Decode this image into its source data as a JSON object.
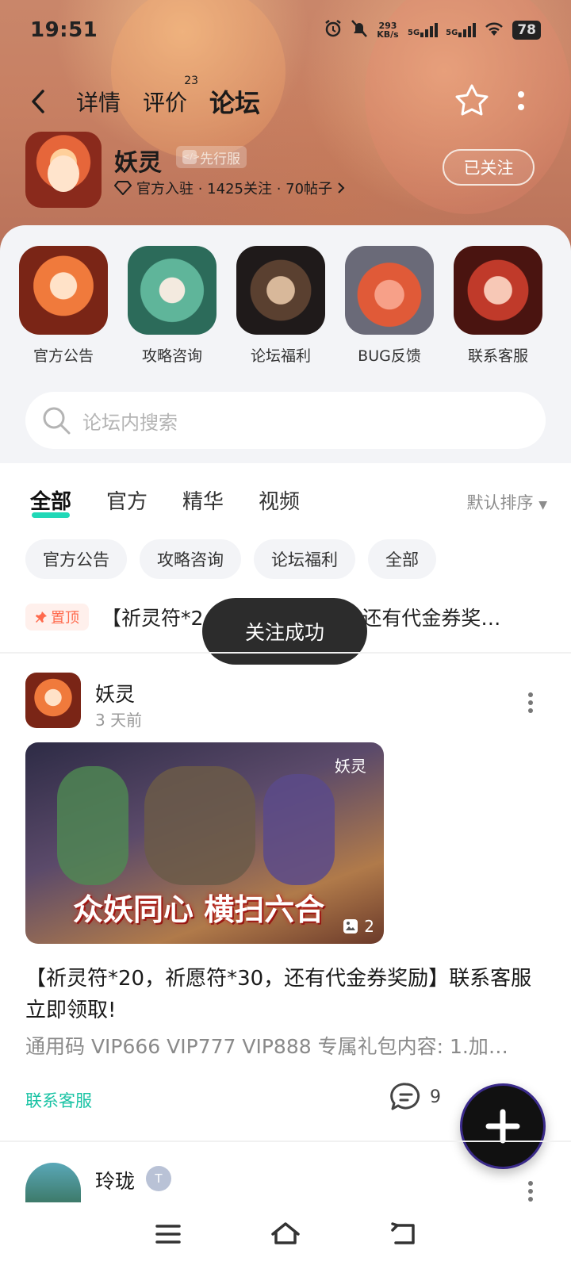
{
  "status_bar": {
    "time": "19:51",
    "net_speed": "293",
    "net_unit": "KB/s",
    "signal_1": "5G",
    "signal_2": "5G",
    "battery": "78"
  },
  "header": {
    "tabs": [
      {
        "label": "详情"
      },
      {
        "label": "评价",
        "badge": "23"
      },
      {
        "label": "论坛",
        "active": true
      }
    ]
  },
  "game": {
    "name": "妖灵",
    "tag": "先行服",
    "meta": "官方入驻 · 1425关注 · 70帖子",
    "follow_label": "已关注"
  },
  "quick_links": [
    {
      "label": "官方公告"
    },
    {
      "label": "攻略咨询"
    },
    {
      "label": "论坛福利"
    },
    {
      "label": "BUG反馈"
    },
    {
      "label": "联系客服"
    }
  ],
  "search": {
    "placeholder": "论坛内搜索"
  },
  "filter_tabs": [
    {
      "label": "全部",
      "active": true
    },
    {
      "label": "官方"
    },
    {
      "label": "精华"
    },
    {
      "label": "视频"
    }
  ],
  "sort_label": "默认排序",
  "chips": [
    {
      "label": "官方公告"
    },
    {
      "label": "攻略咨询"
    },
    {
      "label": "论坛福利"
    },
    {
      "label": "全部"
    }
  ],
  "pinned": {
    "tag": "置顶",
    "text_left": "【祈灵符*2",
    "text_right": "还有代金券奖…"
  },
  "toast": "关注成功",
  "post": {
    "author": "妖灵",
    "time": "3 天前",
    "image_logo": "妖灵",
    "image_banner": "众妖同心 横扫六合",
    "image_count": "2",
    "title": "【祈灵符*20，祈愿符*30，还有代金券奖励】联系客服立即领取!",
    "summary": "通用码 VIP666 VIP777 VIP888 专属礼包内容: 1.加…",
    "category": "联系客服",
    "comments": "9"
  },
  "post2": {
    "author": "玲珑",
    "badge": "T"
  },
  "colors": {
    "accent": "#21d8b7",
    "pin_red": "#ff6a4d"
  }
}
